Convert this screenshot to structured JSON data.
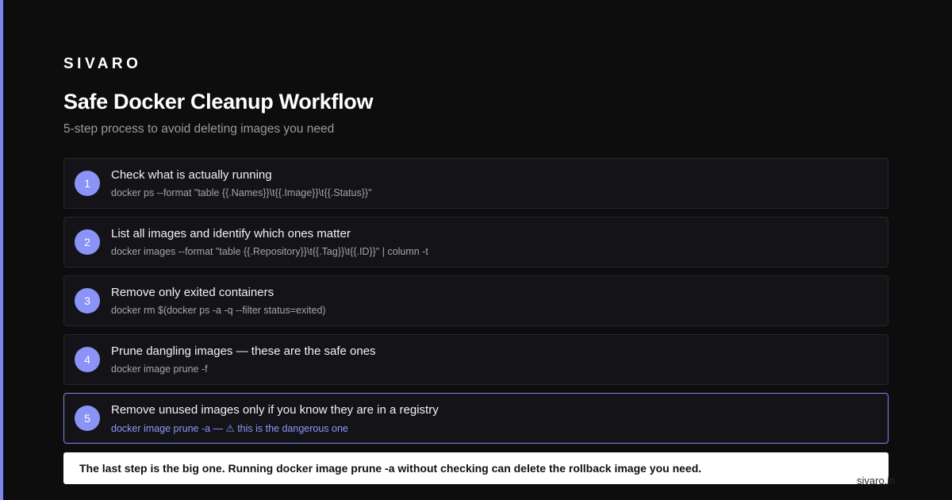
{
  "brand": "SIVARO",
  "title": "Safe Docker Cleanup Workflow",
  "subtitle": "5-step process to avoid deleting images you need",
  "steps": [
    {
      "number": "1",
      "title": "Check what is actually running",
      "command": "docker ps --format \"table {{.Names}}\\t{{.Image}}\\t{{.Status}}\""
    },
    {
      "number": "2",
      "title": "List all images and identify which ones matter",
      "command": "docker images --format \"table {{.Repository}}\\t{{.Tag}}\\t{{.ID}}\" | column -t"
    },
    {
      "number": "3",
      "title": "Remove only exited containers",
      "command": "docker rm $(docker ps -a -q --filter status=exited)"
    },
    {
      "number": "4",
      "title": "Prune dangling images — these are the safe ones",
      "command": "docker image prune -f"
    },
    {
      "number": "5",
      "title": "Remove unused images only if you know they are in a registry",
      "command": "docker image prune -a — ⚠ this is the dangerous one"
    }
  ],
  "callout": "The last step is the big one. Running docker image prune -a without checking can delete the rollback image you need.",
  "watermark": "sivaro.in",
  "colors": {
    "background": "#0d0d0d",
    "accent": "#7c86f0",
    "step_badge": "#8b93f7",
    "card": "#141418"
  }
}
